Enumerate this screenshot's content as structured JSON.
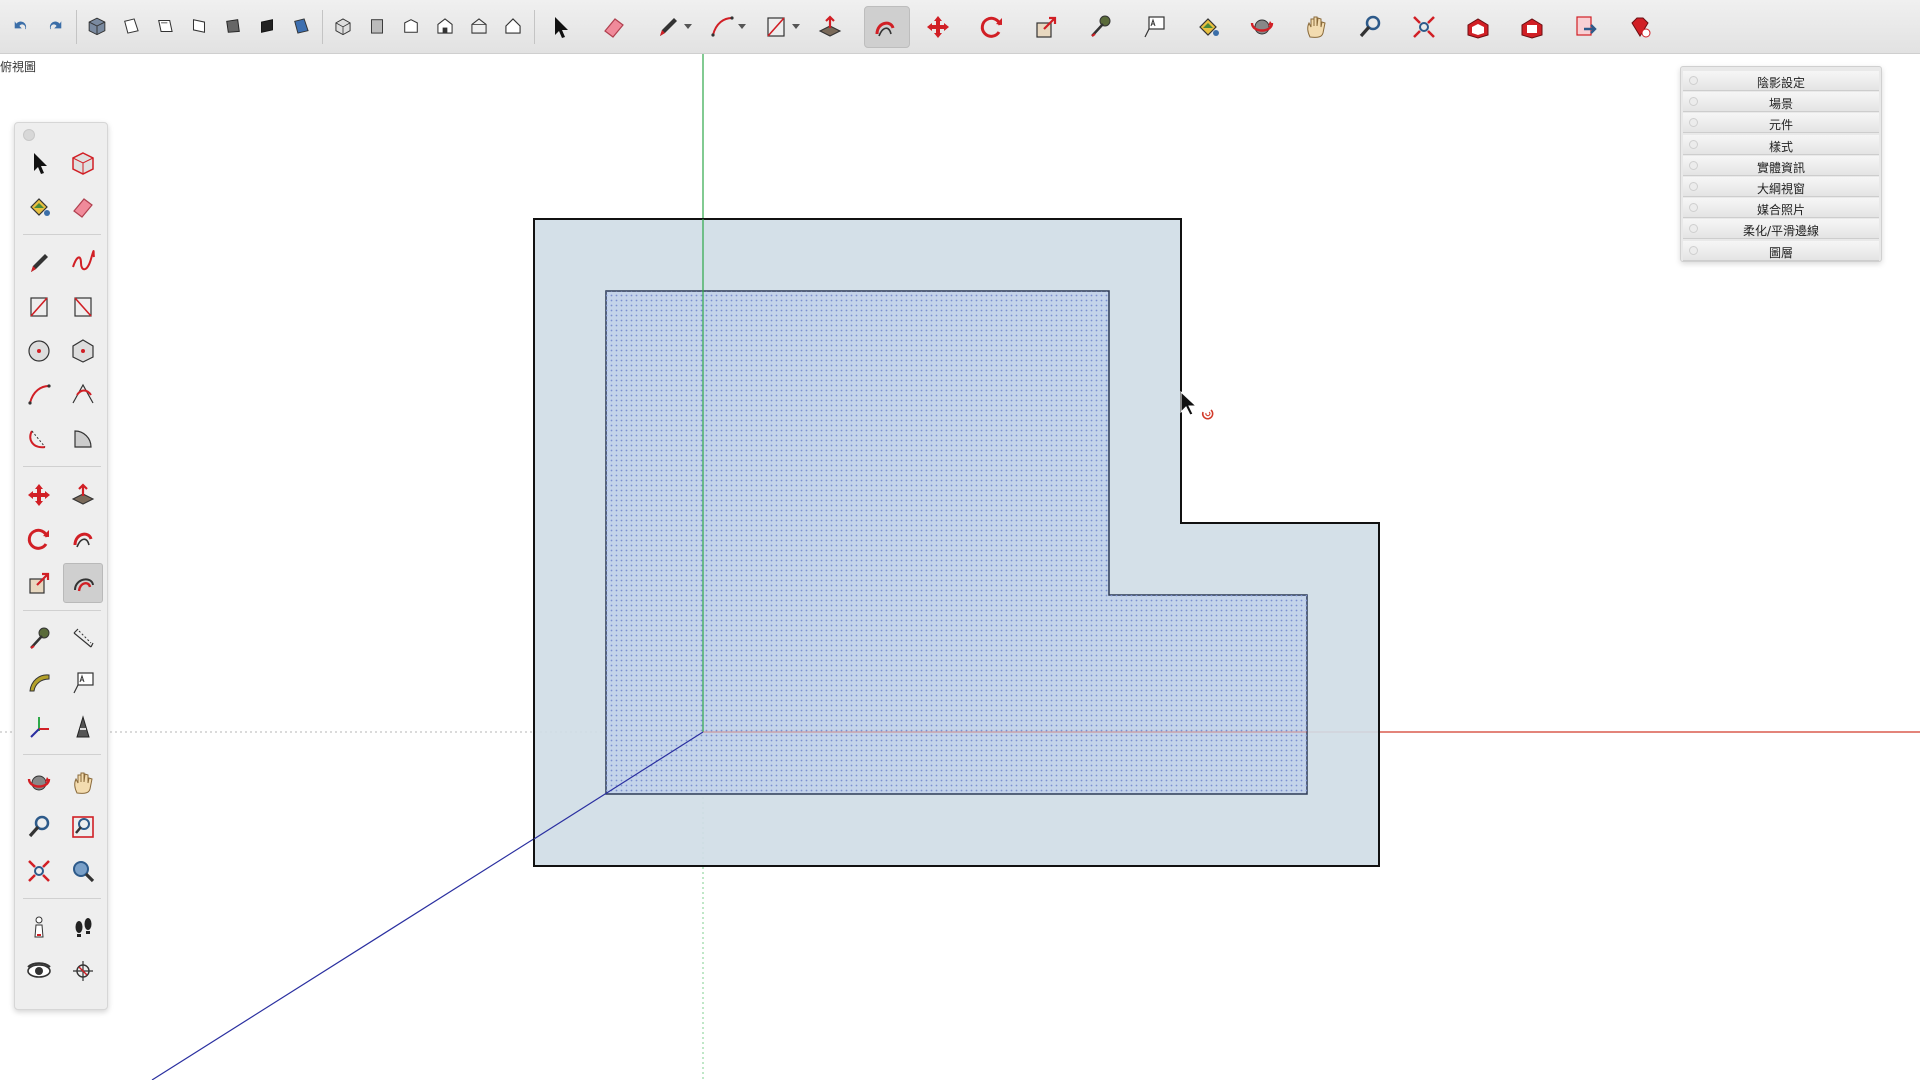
{
  "app": {
    "view_label": "俯視圖"
  },
  "toolbar": {
    "groups": [
      [
        "undo-icon",
        "redo-icon"
      ],
      [
        "iso-view-icon",
        "top-view-icon",
        "front-view-icon",
        "right-view-icon",
        "back-view-icon",
        "left-view-icon",
        "bottom-view-icon"
      ],
      [
        "xray-style-icon",
        "wireframe-style-icon",
        "hidden-line-style-icon",
        "shaded-style-icon",
        "textured-style-icon",
        "monochrome-style-icon"
      ],
      [
        "select-icon",
        "eraser-icon",
        "pencil-icon",
        "arc-icon",
        "rectangle-icon",
        "push-pull-icon",
        "follow-me-icon",
        "move-icon",
        "rotate-icon",
        "scale-icon",
        "tape-measure-icon",
        "text-icon",
        "paint-bucket-icon",
        "orbit-icon",
        "pan-icon",
        "zoom-icon",
        "zoom-extents-icon",
        "warehouse-icon",
        "extension-warehouse-icon",
        "send-to-layout-icon",
        "ruby-console-icon"
      ]
    ],
    "active_tool": "follow-me-icon"
  },
  "palette": {
    "rows": [
      [
        "select-icon",
        "component-icon"
      ],
      [
        "paint-bucket-icon",
        "eraser-icon"
      ],
      [
        "pencil-icon",
        "freehand-icon"
      ],
      [
        "rectangle-icon",
        "rotated-rectangle-icon"
      ],
      [
        "circle-icon",
        "polygon-icon"
      ],
      [
        "arc-icon",
        "two-point-arc-icon"
      ],
      [
        "three-point-arc-icon",
        "pie-icon"
      ],
      [
        "move-icon",
        "push-pull-icon"
      ],
      [
        "rotate-icon",
        "follow-me-icon"
      ],
      [
        "scale-icon",
        "offset-icon"
      ],
      [
        "tape-measure-icon",
        "dimension-icon"
      ],
      [
        "protractor-icon",
        "text-icon"
      ],
      [
        "axes-icon",
        "3d-text-icon"
      ],
      [
        "orbit-icon",
        "pan-icon"
      ],
      [
        "zoom-icon",
        "zoom-window-icon"
      ],
      [
        "zoom-extents-icon",
        "previous-view-icon"
      ],
      [
        "position-camera-icon",
        "walk-icon"
      ],
      [
        "look-around-icon",
        "section-plane-icon"
      ]
    ],
    "active_tool": "offset-icon"
  },
  "tray": {
    "items": [
      "陰影設定",
      "場景",
      "元件",
      "樣式",
      "實體資訊",
      "大綱視窗",
      "媒合照片",
      "柔化/平滑邊線",
      "圖層"
    ]
  },
  "colors": {
    "face": "#d0dde6",
    "selected_face": "#c4d4ea",
    "selection_dot": "#7b8fd0",
    "edge": "#111111",
    "axis_red": "#d23a2a",
    "axis_green": "#2fa84a",
    "axis_blue": "#2a2fa0",
    "accent_red": "#d11f25"
  }
}
